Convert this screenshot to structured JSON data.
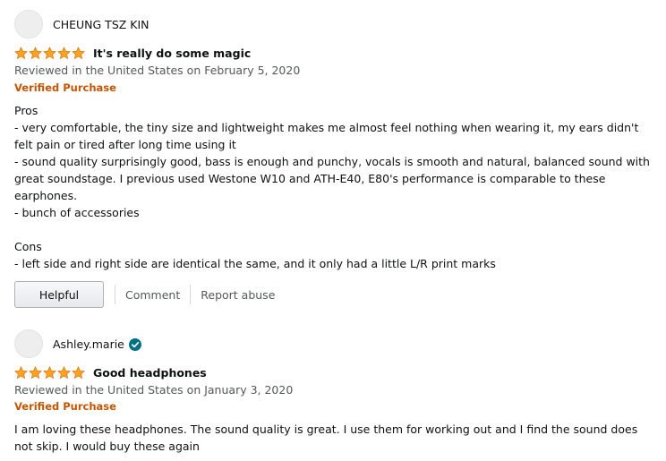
{
  "reviews": [
    {
      "author": "CHEUNG TSZ KIN",
      "rating": 5,
      "title": "It's really do some magic",
      "date": "Reviewed in the United States on February 5, 2020",
      "verified": "Verified Purchase",
      "body": [
        "Pros",
        "- very comfortable, the tiny size and lightweight makes me almost feel nothing when wearing it, my ears didn't",
        "felt pain or tired after long time using it",
        "- sound quality surprisingly good, bass is enough and punchy, vocals is smooth and natural, balanced sound with",
        "great soundstage. I previous used Westone W10 and ATH-E40, E80's performance is comparable to these",
        "earphones.",
        "- bunch of accessories",
        "",
        "Cons",
        "- left side and right side are identical the same, and it only had a little L/R print marks"
      ],
      "helpful_label": "Helpful",
      "comment_label": "Comment",
      "report_label": "Report abuse"
    },
    {
      "author": "Ashley.marie",
      "author_badge": "verified-check-icon",
      "rating": 5,
      "title": "Good headphones",
      "date": "Reviewed in the United States on January 3, 2020",
      "verified": "Verified Purchase",
      "body": [
        "I am loving these headphones. The sound quality is great. I use them for working out and I find the sound does",
        "not skip. I would buy these again"
      ]
    }
  ],
  "colors": {
    "star": "#ffa41c",
    "star_outline": "#de7921",
    "verified_purchase": "#c45500",
    "badge": "#007185"
  }
}
